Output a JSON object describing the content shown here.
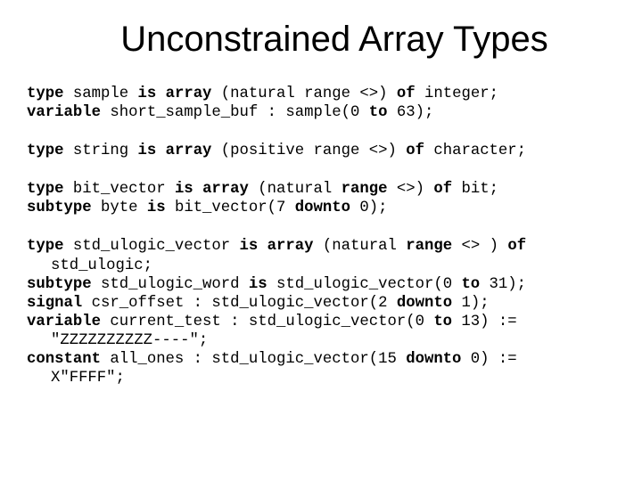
{
  "title": "Unconstrained Array Types",
  "kw": {
    "type": "type",
    "is": "is",
    "array": "array",
    "of": "of",
    "variable": "variable",
    "to": "to",
    "subtype": "subtype",
    "downto": "downto",
    "signal": "signal",
    "constant": "constant",
    "range": "range"
  },
  "b1": {
    "l1a": " sample ",
    "l1b": " (natural range <>) ",
    "l1c": " integer;",
    "l2a": " short_sample_buf : sample(0 ",
    "l2b": " 63);"
  },
  "b2": {
    "l1a": " string ",
    "l1b": " (positive range <>) ",
    "l1c": " character;"
  },
  "b3": {
    "l1a": " bit_vector ",
    "l1b": " (natural ",
    "l1c": " <>) ",
    "l1d": " bit;",
    "l2a": " byte ",
    "l2b": " bit_vector(7 ",
    "l2c": " 0);"
  },
  "b4": {
    "l1a": " std_ulogic_vector ",
    "l1b": " (natural ",
    "l1c": " <> ) ",
    "l1d_cont": "std_ulogic;",
    "l2a": " std_ulogic_word ",
    "l2b": " std_ulogic_vector(0 ",
    "l2c": " 31);",
    "l3a": " csr_offset : std_ulogic_vector(2 ",
    "l3b": " 1);",
    "l4a": " current_test : std_ulogic_vector(0 ",
    "l4b": " 13) :=",
    "l4c_cont": "\"ZZZZZZZZZZ----\";",
    "l5a": " all_ones : std_ulogic_vector(15 ",
    "l5b": " 0) :=",
    "l5c_cont": "X\"FFFF\";"
  }
}
